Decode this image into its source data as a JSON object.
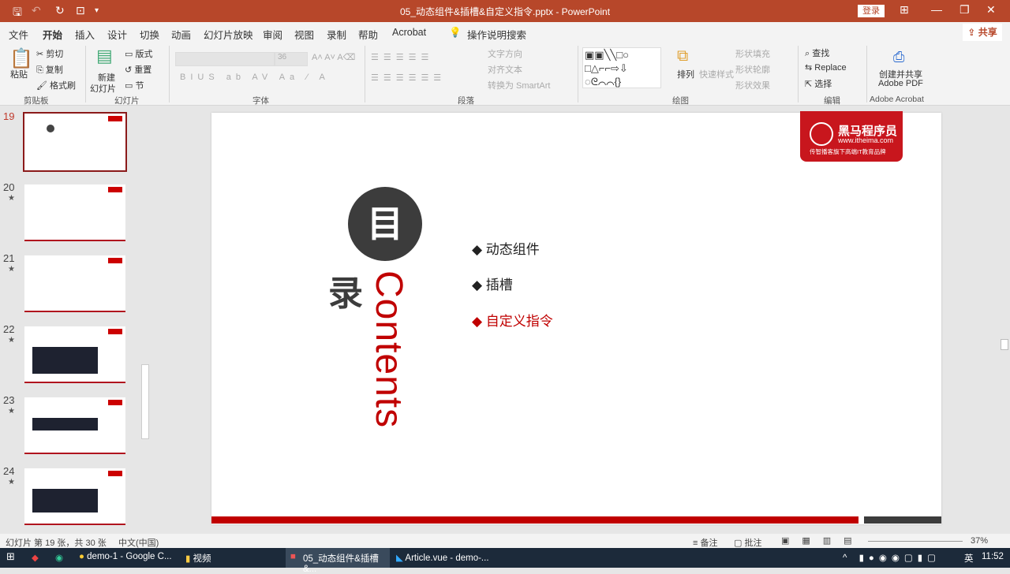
{
  "window": {
    "title": "05_动态组件&插槽&自定义指令.pptx  -  PowerPoint",
    "login": "登录"
  },
  "tabs": [
    "文件",
    "开始",
    "插入",
    "设计",
    "切换",
    "动画",
    "幻灯片放映",
    "审阅",
    "视图",
    "录制",
    "帮助",
    "Acrobat"
  ],
  "search": "操作说明搜索",
  "share": "共享",
  "ribbon": {
    "clipboard": {
      "paste": "粘贴",
      "cut": "剪切",
      "copy": "复制",
      "format": "格式刷",
      "label": "剪贴板"
    },
    "slides": {
      "new": "新建",
      "new2": "幻灯片",
      "layout": "版式",
      "reset": "重置",
      "section": "节",
      "label": "幻灯片"
    },
    "font": {
      "size": "36",
      "label": "字体"
    },
    "paragraph": {
      "dir": "文字方向",
      "align": "对齐文本",
      "smartart": "转换为 SmartArt",
      "label": "段落"
    },
    "drawing": {
      "arrange": "排列",
      "styles": "快速样式",
      "fill": "形状填充",
      "outline": "形状轮廓",
      "effect": "形状效果",
      "label": "绘图"
    },
    "editing": {
      "find": "查找",
      "replace": "Replace",
      "select": "选择",
      "label": "编辑"
    },
    "acrobat": {
      "create": "创建并共享",
      "pdf": "Adobe PDF",
      "label": "Adobe Acrobat"
    }
  },
  "thumbnails": [
    {
      "num": "19"
    },
    {
      "num": "20"
    },
    {
      "num": "21"
    },
    {
      "num": "22"
    },
    {
      "num": "23"
    },
    {
      "num": "24"
    }
  ],
  "slide": {
    "logo_name": "黑马程序员",
    "logo_url": "www.itheima.com",
    "logo_tag": "传智播客旗下高端IT教育品牌",
    "circle_char": "目",
    "lu_char": "录",
    "contents": "Contents",
    "items": [
      "◆ 动态组件",
      "◆ 插槽",
      "◆ 自定义指令"
    ]
  },
  "status": {
    "slide": "幻灯片 第 19 张，共 30 张",
    "lang": "中文(中国)",
    "notes": "备注",
    "comments": "批注",
    "zoom": "37%"
  },
  "taskbar": {
    "chrome": "demo-1 - Google C...",
    "folder": "视频",
    "ppt": "05_动态组件&插槽&...",
    "vscode": "Article.vue - demo-...",
    "ime": "英",
    "time": "11:52"
  }
}
